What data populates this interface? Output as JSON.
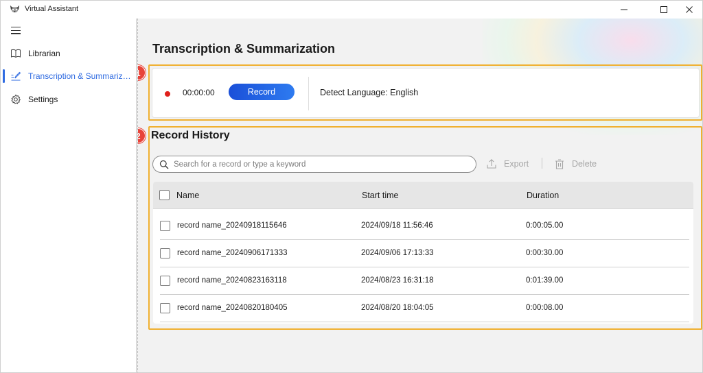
{
  "window": {
    "title": "Virtual Assistant"
  },
  "sidebar": {
    "items": [
      {
        "label": "Librarian",
        "icon": "book-icon"
      },
      {
        "label": "Transcription & Summarizati...",
        "icon": "edit-pen-icon",
        "active": true
      },
      {
        "label": "Settings",
        "icon": "gear-icon"
      }
    ]
  },
  "main": {
    "title": "Transcription & Summarization",
    "recorder": {
      "timer": "00:00:00",
      "record_label": "Record",
      "detect_language": "Detect Language: English",
      "status_color": "#e0201b"
    },
    "history": {
      "title": "Record History",
      "search_placeholder": "Search for a record or type a keyword",
      "export_label": "Export",
      "delete_label": "Delete",
      "columns": [
        "Name",
        "Start time",
        "Duration"
      ],
      "rows": [
        {
          "name": "record name_20240918115646",
          "start": "2024/09/18 11:56:46",
          "duration": "0:00:05.00"
        },
        {
          "name": "record name_20240906171333",
          "start": "2024/09/06 17:13:33",
          "duration": "0:00:30.00"
        },
        {
          "name": "record name_20240823163118",
          "start": "2024/08/23 16:31:18",
          "duration": "0:01:39.00"
        },
        {
          "name": "record name_20240820180405",
          "start": "2024/08/20 18:04:05",
          "duration": "0:00:08.00"
        }
      ]
    },
    "callouts": [
      "1",
      "2"
    ]
  },
  "colors": {
    "accent": "#2f6be1",
    "highlight": "#f0b030",
    "callout": "#e8443a"
  }
}
